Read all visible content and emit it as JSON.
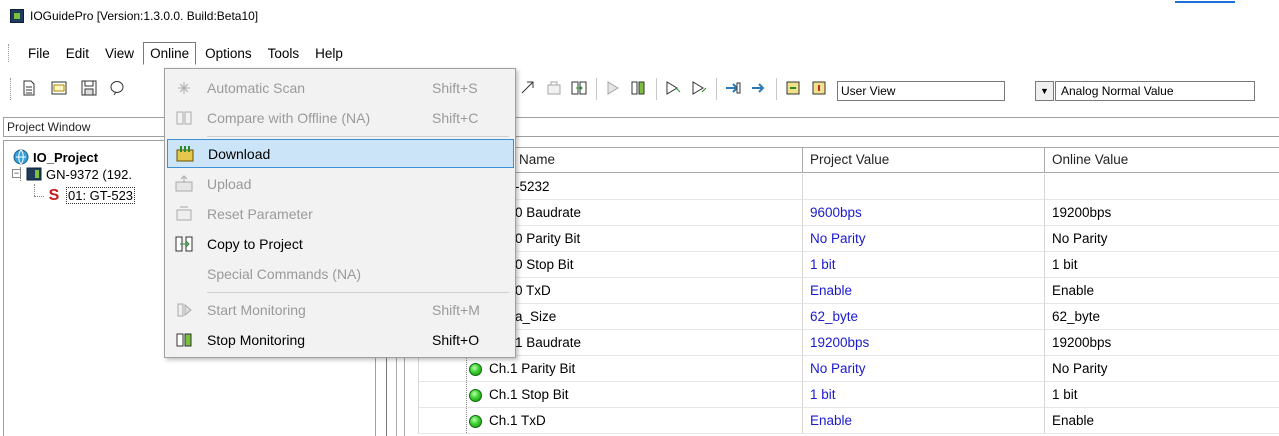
{
  "window": {
    "title": "IOGuidePro  [Version:1.3.0.0. Build:Beta10]"
  },
  "menubar": {
    "items": [
      {
        "label": "File"
      },
      {
        "label": "Edit"
      },
      {
        "label": "View"
      },
      {
        "label": "Online"
      },
      {
        "label": "Options"
      },
      {
        "label": "Tools"
      },
      {
        "label": "Help"
      }
    ],
    "open_menu": "Online"
  },
  "toolbar": {
    "view_select": "User View",
    "value_select": "Analog Normal Value"
  },
  "online_menu": {
    "items": [
      {
        "label": "Automatic Scan",
        "shortcut": "Shift+S",
        "enabled": false,
        "icon": "scan-icon"
      },
      {
        "label": "Compare with Offline (NA)",
        "shortcut": "Shift+C",
        "enabled": false,
        "icon": "compare-icon"
      },
      {
        "label": "Download",
        "shortcut": "",
        "enabled": true,
        "highlighted": true,
        "icon": "download-icon"
      },
      {
        "label": "Upload",
        "shortcut": "",
        "enabled": false,
        "icon": "upload-icon"
      },
      {
        "label": "Reset Parameter",
        "shortcut": "",
        "enabled": false,
        "icon": "reset-icon"
      },
      {
        "label": "Copy to Project",
        "shortcut": "",
        "enabled": true,
        "icon": "copy-icon"
      },
      {
        "label": "Special Commands (NA)",
        "shortcut": "",
        "enabled": false,
        "icon": ""
      },
      {
        "label": "Start Monitoring",
        "shortcut": "Shift+M",
        "enabled": false,
        "icon": "start-monitor-icon"
      },
      {
        "label": "Stop Monitoring",
        "shortcut": "Shift+O",
        "enabled": true,
        "icon": "stop-monitor-icon"
      }
    ]
  },
  "project_window": {
    "header": "Project Window",
    "tree": {
      "root": "IO_Project",
      "device": "GN-9372 (192.",
      "module": "01: GT-523"
    }
  },
  "grid": {
    "columns": [
      "Name",
      "Project Value",
      "Online Value"
    ],
    "rows": [
      {
        "name": "-5232",
        "project": "",
        "online": "",
        "led": false
      },
      {
        "name": "0 Baudrate",
        "project": "9600bps",
        "online": "19200bps",
        "led": false
      },
      {
        "name": "0 Parity Bit",
        "project": "No Parity",
        "online": "No Parity",
        "led": false
      },
      {
        "name": "0 Stop Bit",
        "project": "1 bit",
        "online": "1 bit",
        "led": false
      },
      {
        "name": "0 TxD",
        "project": "Enable",
        "online": "Enable",
        "led": false
      },
      {
        "name": "a_Size",
        "project": "62_byte",
        "online": "62_byte",
        "led": false
      },
      {
        "name": "1 Baudrate",
        "project": "19200bps",
        "online": "19200bps",
        "led": false
      },
      {
        "name": "Ch.1 Parity Bit",
        "project": "No Parity",
        "online": "No Parity",
        "led": true
      },
      {
        "name": "Ch.1 Stop Bit",
        "project": "1 bit",
        "online": "1 bit",
        "led": true
      },
      {
        "name": "Ch.1 TxD",
        "project": "Enable",
        "online": "Enable",
        "led": true
      }
    ]
  },
  "colors": {
    "highlight_bg": "#cce4f7",
    "highlight_border": "#3a8fd6",
    "project_value_text": "#1a1acc",
    "led_green": "#3ccf30"
  }
}
